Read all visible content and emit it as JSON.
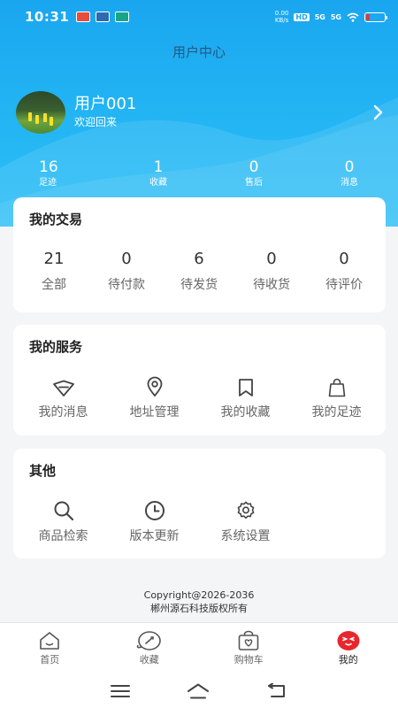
{
  "status_bar": {
    "time": "10:31",
    "speed_value": "0.00",
    "speed_unit": "KB/s",
    "hd_label": "HD",
    "sim1": "5G",
    "sim2": "5G",
    "battery_level": 0.2
  },
  "header": {
    "title": "用户中心"
  },
  "profile": {
    "name": "用户001",
    "subtitle": "欢迎回来"
  },
  "stats": [
    {
      "value": "16",
      "label": "足迹"
    },
    {
      "value": "1",
      "label": "收藏"
    },
    {
      "value": "0",
      "label": "售后"
    },
    {
      "value": "0",
      "label": "消息"
    }
  ],
  "trade": {
    "title": "我的交易",
    "items": [
      {
        "value": "21",
        "label": "全部"
      },
      {
        "value": "0",
        "label": "待付款"
      },
      {
        "value": "6",
        "label": "待发货"
      },
      {
        "value": "0",
        "label": "待收货"
      },
      {
        "value": "0",
        "label": "待评价"
      }
    ]
  },
  "services": {
    "title": "我的服务",
    "items": [
      {
        "label": "我的消息",
        "icon": "message-icon"
      },
      {
        "label": "地址管理",
        "icon": "location-pin-icon"
      },
      {
        "label": "我的收藏",
        "icon": "bookmark-icon"
      },
      {
        "label": "我的足迹",
        "icon": "shopping-bag-icon"
      }
    ]
  },
  "other": {
    "title": "其他",
    "items": [
      {
        "label": "商品检索",
        "icon": "search-icon"
      },
      {
        "label": "版本更新",
        "icon": "clock-icon"
      },
      {
        "label": "系统设置",
        "icon": "gear-icon"
      }
    ]
  },
  "footer": {
    "copyright": "Copyright@2026-2036",
    "company": "郴州源石科技版权所有"
  },
  "tabbar": [
    {
      "label": "首页",
      "icon": "home-icon"
    },
    {
      "label": "收藏",
      "icon": "favorites-icon"
    },
    {
      "label": "购物车",
      "icon": "cart-icon"
    },
    {
      "label": "我的",
      "icon": "profile-icon",
      "active": true
    }
  ],
  "colors": {
    "header_blue": "#1aa6ef",
    "active_red": "#e8262d",
    "icon_gray": "#555555"
  }
}
